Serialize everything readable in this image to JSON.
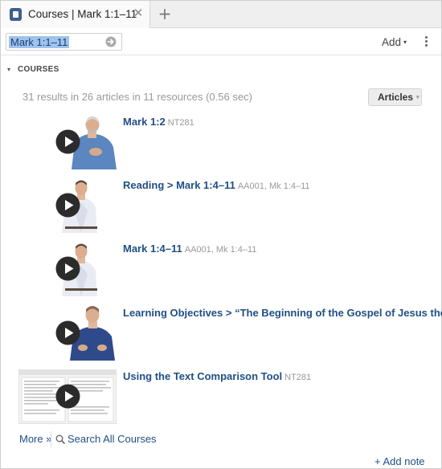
{
  "tab": {
    "icon": "logos-book-icon",
    "title": "Courses | Mark 1:1–11",
    "close_glyph": "✕",
    "new_tab_glyph": "+"
  },
  "toolbar": {
    "reference_value": "Mark 1:1–11",
    "go_icon": "go-arrow-icon",
    "add_label": "Add",
    "add_caret": "▾",
    "menu_icon": "kebab-menu-icon"
  },
  "section": {
    "toggle_glyph": "▾",
    "title": "COURSES",
    "summary": "31 results in 26 articles in 11 resources (0.56 sec)",
    "filter_label": "Articles",
    "filter_caret": "▾"
  },
  "results": [
    {
      "title": "Mark 1:2",
      "ref": "NT281",
      "thumb": "video-presenter-bearded"
    },
    {
      "title": "Reading > Mark 1:4–11",
      "ref": "AA001, Mk 1:4–11",
      "thumb": "video-presenter-light-shirt"
    },
    {
      "title": "Mark 1:4–11",
      "ref": "AA001, Mk 1:4–11",
      "thumb": "video-presenter-light-shirt"
    },
    {
      "title": "Learning Objectives > “The Beginning of the Gospel of Jesus the",
      "ref": "",
      "thumb": "video-presenter-dark-shirt"
    },
    {
      "title": "Using the Text Comparison Tool",
      "ref": "NT281",
      "thumb": "video-software-screenshot"
    }
  ],
  "footer": {
    "more_label": "More »",
    "search_all_label": "Search All Courses",
    "add_note_label": "+ Add note"
  },
  "colors": {
    "link": "#1f4f85",
    "muted": "#999999",
    "selection": "#9ec3ec",
    "tab_icon": "#3d5f8d"
  }
}
